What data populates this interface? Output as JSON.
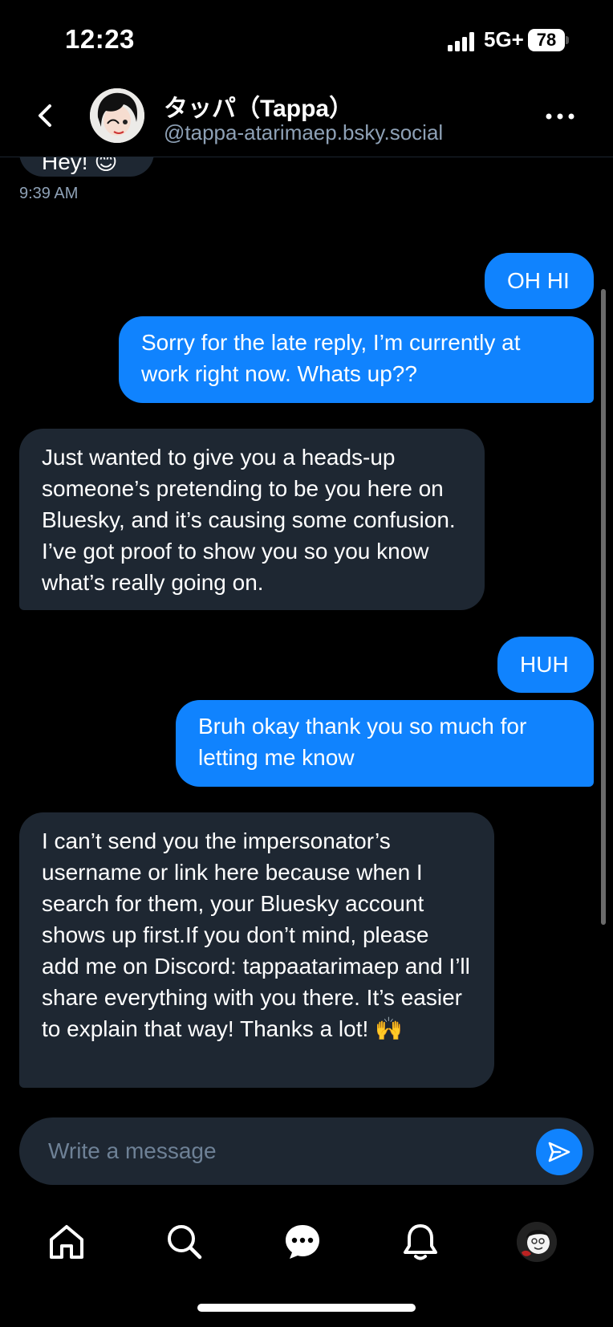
{
  "status_bar": {
    "time": "12:23",
    "network": "5G+",
    "battery": "78"
  },
  "header": {
    "display_name": "タッパ（Tappa）",
    "handle": "@tappa-atarimaep.bsky.social"
  },
  "conversation": {
    "partial_message_text": "Hey! 😊",
    "timestamp": "9:39 AM",
    "messages": [
      {
        "direction": "out",
        "text": "OH HI"
      },
      {
        "direction": "out",
        "text": "Sorry for the late reply, I’m currently at work right now. Whats up??"
      },
      {
        "direction": "in",
        "text": "Just wanted to give you a heads-up someone’s pretending to be you here on Bluesky, and it’s causing some confusion. I’ve got proof to show you so you know what’s really going on."
      },
      {
        "direction": "out",
        "text": "HUH"
      },
      {
        "direction": "out",
        "text": "Bruh okay thank you so much for letting me know"
      },
      {
        "direction": "in",
        "text": "I can’t send you the impersonator’s username or link here because when I search for them, your Bluesky account shows up first.If you don’t mind, please add me on Discord: tappaatarimaep and I’ll share everything with you there. It’s easier to explain that way! Thanks a lot! 🙌"
      }
    ]
  },
  "composer": {
    "placeholder": "Write a message"
  },
  "nav": [
    "home-icon",
    "search-icon",
    "chat-icon",
    "bell-icon",
    "profile-avatar"
  ],
  "colors": {
    "accent": "#1083fe",
    "incoming_bubble": "#1e2732",
    "secondary_text": "#8ea1b6",
    "background": "#000000"
  }
}
